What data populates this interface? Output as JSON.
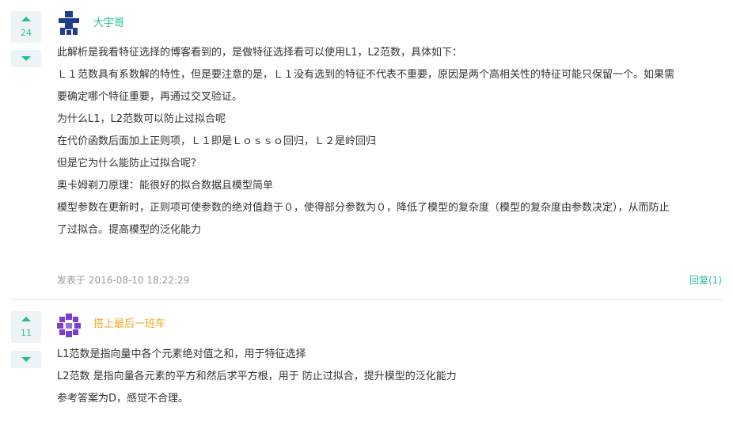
{
  "colors": {
    "accent": "#25bb9b",
    "username1": "#25bb9b",
    "username2": "#f5a623",
    "text": "#333333",
    "meta": "#999999",
    "vote_bg": "#eef4f6"
  },
  "comments": [
    {
      "votes": "24",
      "username": "大宇哥",
      "avatar_icon": "cross-pixel-avatar-icon",
      "lines": [
        "此解析是我看特征选择的博客看到的，是做特征选择看可以使用L1，L2范数，具体如下：",
        "Ｌ１范数具有系数解的特性，但是要注意的是，Ｌ１没有选到的特征不代表不重要，原因是两个高相关性的特征可能只保留一个。如果需",
        "要确定哪个特征重要，再通过交叉验证。",
        "为什么L1，L2范数可以防止过拟合呢",
        "在代价函数后面加上正则项，Ｌ１即是Ｌｏｓｓｏ回归，Ｌ２是岭回归",
        "但是它为什么能防止过拟合呢？",
        "奥卡姆剃刀原理：能很好的拟合数据且模型简单",
        "模型参数在更新时，正则项可使参数的绝对值趋于０，使得部分参数为０，降低了模型的复杂度（模型的复杂度由参数决定），从而防止",
        "了过拟合。提高模型的泛化能力"
      ],
      "posted": "发表于 2016-08-10 18:22:29",
      "reply": "回复(1)"
    },
    {
      "votes": "11",
      "username": "搭上最后一班车",
      "avatar_icon": "purple-pixel-avatar-icon",
      "lines": [
        "L1范数是指向量中各个元素绝对值之和，用于特征选择",
        "L2范数 是指向量各元素的平方和然后求平方根，用于 防止过拟合，提升模型的泛化能力",
        "参考答案为D，感觉不合理。"
      ]
    }
  ]
}
